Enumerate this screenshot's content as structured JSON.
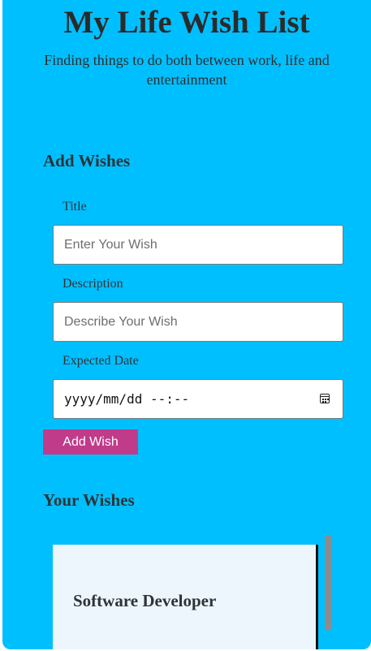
{
  "header": {
    "title": "My Life Wish List",
    "subtitle": "Finding things to do both between work, life and entertainment"
  },
  "add_form": {
    "heading": "Add Wishes",
    "title_label": "Title",
    "title_placeholder": "Enter Your Wish",
    "description_label": "Description",
    "description_placeholder": "Describe Your Wish",
    "date_label": "Expected Date",
    "date_value": "yyyy/mm/dd --:--",
    "button_label": "Add Wish"
  },
  "wishes": {
    "heading": "Your Wishes",
    "items": [
      {
        "title": "Software Developer"
      }
    ]
  },
  "icons": {
    "date_picker": "calendar-icon"
  },
  "colors": {
    "background": "#00bfff",
    "button": "#c13b8b",
    "card": "#eef6fd"
  }
}
